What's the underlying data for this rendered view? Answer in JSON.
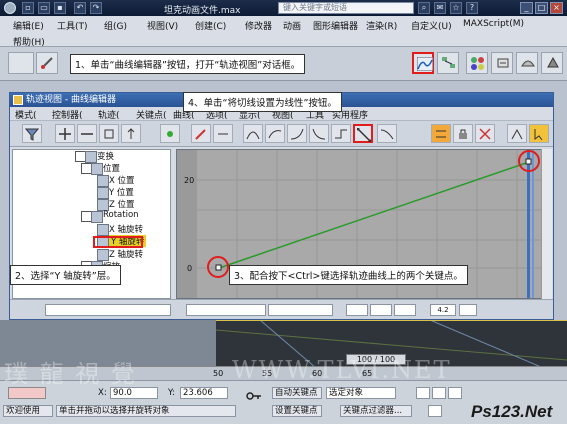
{
  "max_window": {
    "file_title": "坦克动画文件.max",
    "search_placeholder": "键入关键字或短语",
    "menu": [
      "编辑(E)",
      "工具(T)",
      "组(G)",
      "视图(V)",
      "创建(C)",
      "修改器",
      "动画",
      "图形编辑器",
      "渲染(R)",
      "自定义(U)",
      "MAXScript(M)"
    ],
    "help": "帮助(H)"
  },
  "callouts": {
    "step1": "1、单击“曲线编辑器”按钮，打开“轨迹视图”对话框。",
    "step2": "2、选择“Y 轴旋转”层。",
    "step3": "3、配合按下<Ctrl>键选择轨迹曲线上的两个关键点。",
    "step4": "4、单击“将切线设置为线性”按钮。"
  },
  "trackview": {
    "title": "轨迹视图 - 曲线编辑器",
    "menu": [
      "模式(",
      "控制器(",
      "轨迹(",
      "关键点(",
      "曲线(",
      "选项(",
      "显示(",
      "视图(",
      "工具",
      "实用程序"
    ],
    "tree": [
      {
        "label": "变换",
        "indent": 0
      },
      {
        "label": "位置",
        "indent": 1
      },
      {
        "label": "X 位置",
        "indent": 2
      },
      {
        "label": "Y 位置",
        "indent": 2
      },
      {
        "label": "Z 位置",
        "indent": 2
      },
      {
        "label": "Rotation",
        "indent": 1
      },
      {
        "label": "X 轴旋转",
        "indent": 2
      },
      {
        "label": "Y 轴旋转",
        "indent": 2
      },
      {
        "label": "Z 轴旋转",
        "indent": 2
      },
      {
        "label": "缩放",
        "indent": 1
      }
    ],
    "y_tick_top": "20",
    "y_tick_zero": "0",
    "key_value_field": "4.2"
  },
  "status": {
    "x_label": "X:",
    "x_value": "90.0",
    "y_label": "Y:",
    "y_value": "23.606",
    "mode_label": "欢迎使用",
    "prompt": "单击并拖动以选择并旋转对象",
    "auto_key": "自动关键点",
    "set_key": "设置关键点",
    "selected_object": "选定对象",
    "key_filter": "关键点过滤器...",
    "frame_counter": "100 / 100",
    "timeline_ticks": [
      "50",
      "55",
      "60",
      "65"
    ]
  },
  "watermark": {
    "left": "璞 龍 視 覺",
    "url": "WWW.TLVI.NET"
  },
  "brand": "Ps123.Net"
}
